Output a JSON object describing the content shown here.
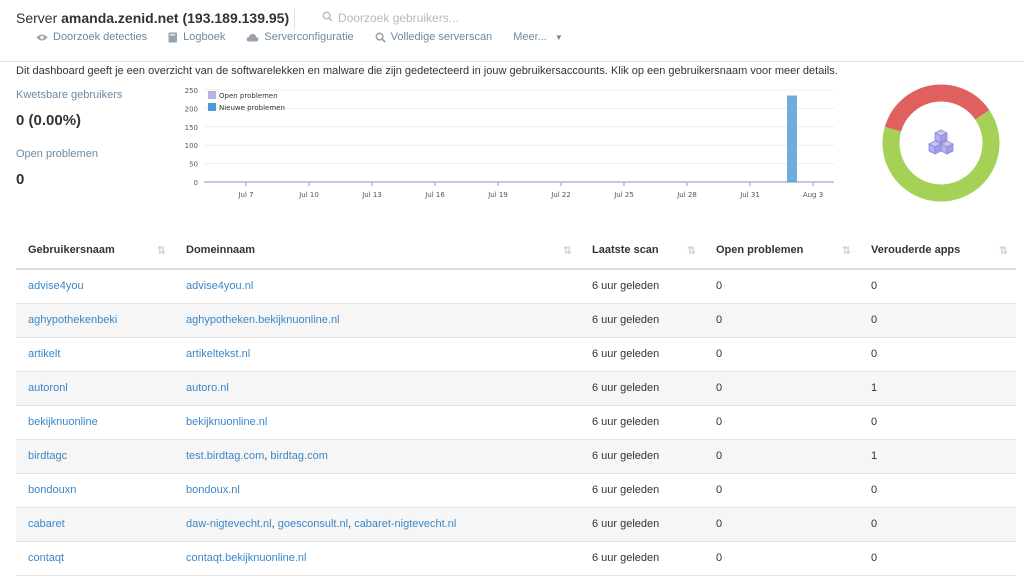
{
  "header": {
    "server_prefix": "Server",
    "server_name": "amanda.zenid.net (193.189.139.95)",
    "search_placeholder": "Doorzoek gebruikers...",
    "nav": [
      {
        "label": "Doorzoek detecties",
        "icon": "eye-icon"
      },
      {
        "label": "Logboek",
        "icon": "book-icon"
      },
      {
        "label": "Serverconfiguratie",
        "icon": "cloud-icon"
      },
      {
        "label": "Volledige serverscan",
        "icon": "search-icon"
      },
      {
        "label": "Meer...",
        "icon": "caret-down-icon"
      }
    ]
  },
  "intro": "Dit dashboard geeft je een overzicht van de softwarelekken en malware die zijn gedetecteerd in jouw gebruikersaccounts. Klik op een gebruikersnaam voor meer details.",
  "stats": {
    "vulnerable_label": "Kwetsbare gebruikers",
    "vulnerable_value": "0 (0.00%)",
    "open_label": "Open problemen",
    "open_value": "0"
  },
  "chart_data": {
    "type": "bar",
    "y_ticks": [
      0,
      50,
      100,
      150,
      200,
      250
    ],
    "ylim": [
      0,
      250
    ],
    "x_ticks": [
      "Jul 7",
      "Jul 10",
      "Jul 13",
      "Jul 16",
      "Jul 19",
      "Jul 22",
      "Jul 25",
      "Jul 28",
      "Jul 31",
      "Aug 3"
    ],
    "legend": [
      "Open problemen",
      "Nieuwe problemen"
    ],
    "legend_position": "top-left",
    "series": [
      {
        "name": "Open problemen",
        "color": "#b6b4e0",
        "points": [
          {
            "x": "Jul 5",
            "y": 0
          },
          {
            "x": "Aug 4",
            "y": 0
          }
        ]
      },
      {
        "name": "Nieuwe problemen",
        "color": "#4a9ad6",
        "points": [
          {
            "x": "Aug 2",
            "y": 235
          }
        ]
      }
    ]
  },
  "donut": {
    "segments": [
      {
        "color": "#e06060",
        "fraction": 0.36
      },
      {
        "color": "#a6d157",
        "fraction": 0.64
      }
    ],
    "icon": "cubes-icon"
  },
  "table": {
    "headers": [
      "Gebruikersnaam",
      "Domeinnaam",
      "Laatste scan",
      "Open problemen",
      "Verouderde apps"
    ],
    "rows": [
      {
        "user": "advise4you",
        "domains": [
          "advise4you.nl"
        ],
        "scan": "6 uur geleden",
        "open": "0",
        "outdated": "0"
      },
      {
        "user": "aghypothekenbeki",
        "domains": [
          "aghypotheken.bekijknuonline.nl"
        ],
        "scan": "6 uur geleden",
        "open": "0",
        "outdated": "0"
      },
      {
        "user": "artikelt",
        "domains": [
          "artikeltekst.nl"
        ],
        "scan": "6 uur geleden",
        "open": "0",
        "outdated": "0"
      },
      {
        "user": "autoronl",
        "domains": [
          "autoro.nl"
        ],
        "scan": "6 uur geleden",
        "open": "0",
        "outdated": "1"
      },
      {
        "user": "bekijknuonline",
        "domains": [
          "bekijknuonline.nl"
        ],
        "scan": "6 uur geleden",
        "open": "0",
        "outdated": "0"
      },
      {
        "user": "birdtagc",
        "domains": [
          "test.birdtag.com",
          "birdtag.com"
        ],
        "scan": "6 uur geleden",
        "open": "0",
        "outdated": "1"
      },
      {
        "user": "bondouxn",
        "domains": [
          "bondoux.nl"
        ],
        "scan": "6 uur geleden",
        "open": "0",
        "outdated": "0"
      },
      {
        "user": "cabaret",
        "domains": [
          "daw-nigtevecht.nl",
          "goesconsult.nl",
          "cabaret-nigtevecht.nl"
        ],
        "scan": "6 uur geleden",
        "open": "0",
        "outdated": "0"
      },
      {
        "user": "contaqt",
        "domains": [
          "contaqt.bekijknuonline.nl"
        ],
        "scan": "6 uur geleden",
        "open": "0",
        "outdated": "0"
      }
    ]
  }
}
